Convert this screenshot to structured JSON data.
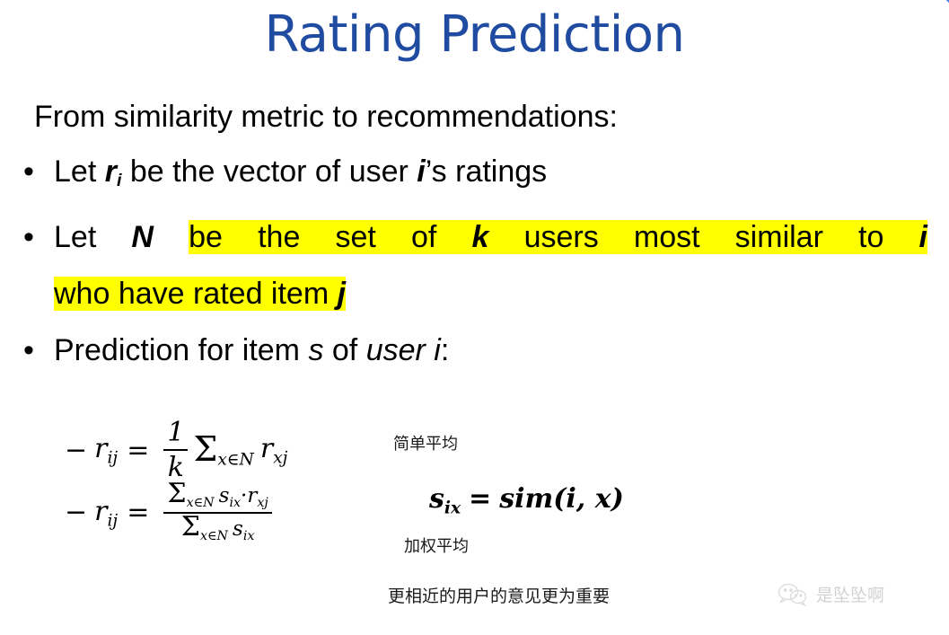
{
  "slide": {
    "title": "Rating Prediction",
    "title_color": "#1f4ba0",
    "highlight_color": "#ffff00",
    "background": "#ffffff"
  },
  "lead": {
    "text": "From similarity metric to recommendations:"
  },
  "bullets": [
    {
      "marker": "•",
      "segments": [
        {
          "text": "Let ",
          "style": "normal"
        },
        {
          "text": "r",
          "style": "bold-italic"
        },
        {
          "text": "i",
          "style": "subscript"
        },
        {
          "text": " be the vector of user ",
          "style": "normal"
        },
        {
          "text": "i",
          "style": "bold-italic"
        },
        {
          "text": "’s ratings",
          "style": "normal"
        }
      ]
    },
    {
      "marker": "•",
      "line1_lead": "Let ",
      "line1_bold": "N",
      "highlighted": true,
      "line1_hl": [
        {
          "text": "be the set of ",
          "style": "normal"
        },
        {
          "text": "k",
          "style": "bold-italic"
        },
        {
          "text": " users most similar to ",
          "style": "normal"
        },
        {
          "text": "i",
          "style": "bold-italic"
        }
      ],
      "line2_hl": [
        {
          "text": "who have rated item ",
          "style": "normal"
        },
        {
          "text": "j",
          "style": "bold-italic"
        }
      ]
    },
    {
      "marker": "•",
      "segments": [
        {
          "text": "Prediction for item ",
          "style": "normal"
        },
        {
          "text": "s",
          "style": "italic"
        },
        {
          "text": " of ",
          "style": "normal"
        },
        {
          "text": "user i",
          "style": "italic"
        },
        {
          "text": ":",
          "style": "normal"
        }
      ]
    }
  ],
  "equations": {
    "eq1": {
      "dash": "−",
      "lhs": "r",
      "lhs_sub": "ij",
      "equals": "=",
      "frac_num": "1",
      "frac_den": "k",
      "sigma": "Σ",
      "sigma_sub": "x∈N",
      "term": "r",
      "term_sub": "xj",
      "note": "简单平均"
    },
    "eq2": {
      "dash": "−",
      "lhs": "r",
      "lhs_sub": "ij",
      "equals": "=",
      "num_sigma": "Σ",
      "num_sigma_sub": "x∈N",
      "num_term1": "s",
      "num_term1_sub": "ix",
      "num_dot": "·",
      "num_term2": "r",
      "num_term2_sub": "xj",
      "den_sigma": "Σ",
      "den_sigma_sub": "x∈N",
      "den_term": "s",
      "den_term_sub": "ix",
      "note": "加权平均"
    },
    "sim_def": {
      "lhs": "s",
      "lhs_sub": "ix",
      "equals": "=",
      "rhs": "sim(i, x)"
    },
    "footnote": "更相近的用户的意见更为重要"
  },
  "watermark": {
    "icon": "wechat-icon",
    "text": "是坠坠啊"
  }
}
